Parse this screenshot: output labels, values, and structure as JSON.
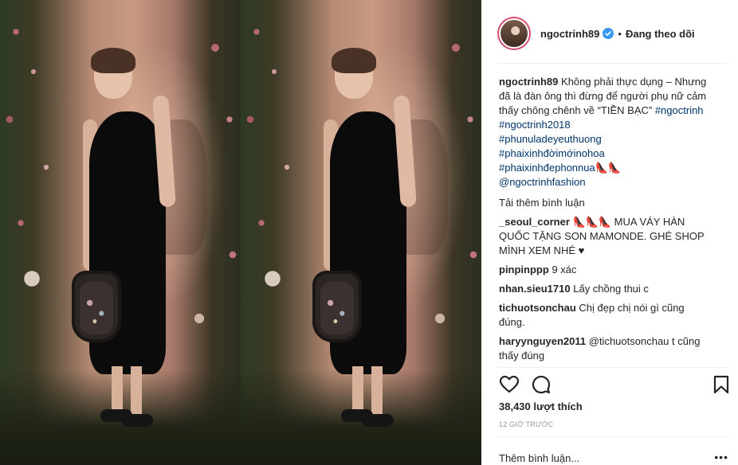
{
  "post": {
    "username": "ngoctrinh89",
    "separator": "•",
    "follow_status": "Đang theo dõi",
    "caption_user": "ngoctrinh89",
    "caption_text": "Không phải thực dụng – Nhưng đã là đàn ông thì đừng để người phụ nữ cảm thấy chông chênh về “TIỀN BẠC”",
    "caption_inline_tags": "#ngoctrinh #ngoctrinh2018",
    "caption_tags": [
      "#phunuladeyeuthuong",
      "#phaixinhđờimớinohoa",
      "#phaixinhđephonnua👠👠",
      "@ngoctrinhfashion"
    ],
    "load_more": "Tải thêm bình luận"
  },
  "comments": [
    {
      "user": "_seoul_corner",
      "text": "👠👠👠 MUA VÁY HÀN QUỐC TẶNG SON MAMONDE. GHÉ SHOP MÌNH XEM NHÉ ♥"
    },
    {
      "user": "pinpinppp",
      "text": "9 xác"
    },
    {
      "user": "nhan.sieu1710",
      "text": "Lấy chồng thui c"
    },
    {
      "user": "tichuotsonchau",
      "text": "Chị đẹp chị nói gì cũng đúng."
    },
    {
      "user": "haryynguyen2011",
      "text": "@tichuotsonchau t cũng thấy đúng"
    }
  ],
  "footer": {
    "likes": "38,430 lượt thích",
    "time": "12 GIỜ TRƯỚC",
    "add_comment_placeholder": "Thêm bình luận...",
    "more": "•••"
  },
  "icons": {
    "like": "heart-icon",
    "comment": "comment-icon",
    "save": "bookmark-icon",
    "verified": "verified-badge-icon"
  },
  "colors": {
    "text": "#262626",
    "hashtag": "#003569",
    "verified": "#3897f0",
    "avatar_ring": "#d64e71",
    "muted": "#999999"
  }
}
